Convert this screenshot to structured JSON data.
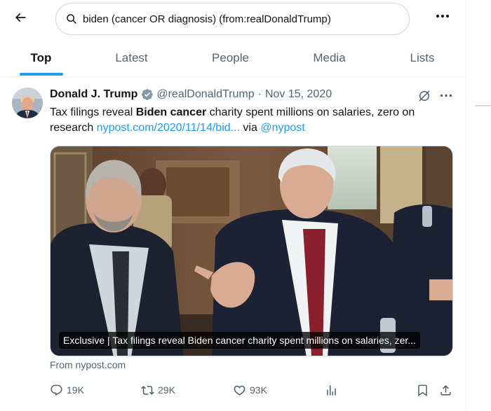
{
  "header": {
    "search_query": "biden (cancer OR diagnosis) (from:realDonaldTrump)",
    "back_icon": "arrow-left-icon",
    "more_icon": "more-horizontal-icon"
  },
  "tabs": [
    {
      "label": "Top",
      "active": true
    },
    {
      "label": "Latest",
      "active": false
    },
    {
      "label": "People",
      "active": false
    },
    {
      "label": "Media",
      "active": false
    },
    {
      "label": "Lists",
      "active": false
    }
  ],
  "tweet": {
    "display_name": "Donald J. Trump",
    "handle": "@realDonaldTrump",
    "separator": "·",
    "date": "Nov 15, 2020",
    "text_before": "Tax filings reveal ",
    "text_bold": "Biden cancer",
    "text_after": " charity spent millions on salaries, zero on research ",
    "link_text": "nypost.com/2020/11/14/bid...",
    "via_text": " via ",
    "mention": "@nypost",
    "card_caption": "Exclusive | Tax filings reveal Biden cancer charity spent millions on salaries, zer...",
    "card_source": "From nypost.com",
    "stats": {
      "replies": "19K",
      "reposts": "29K",
      "likes": "93K"
    }
  },
  "colors": {
    "accent": "#1d9bf0",
    "text": "#0f1419",
    "secondary": "#536471",
    "verified": "#829aab"
  }
}
